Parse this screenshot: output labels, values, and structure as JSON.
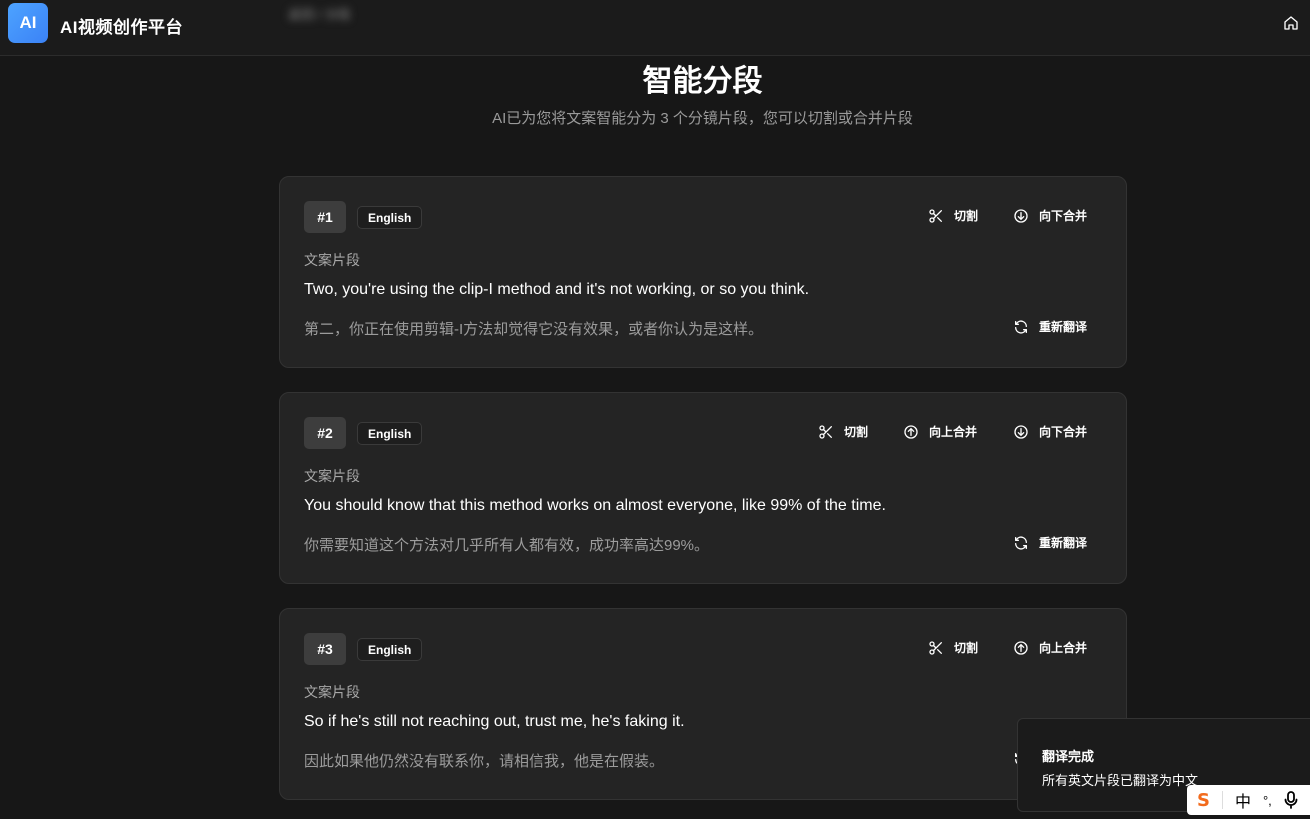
{
  "app": {
    "logo": "AI",
    "title": "AI视频创作平台",
    "breadcrumb_blurred": "返回 / 分段"
  },
  "page": {
    "title": "智能分段",
    "subtitle": "AI已为您将文案智能分为 3 个分镜片段，您可以切割或合并片段"
  },
  "labels": {
    "cut": "切割",
    "merge_up": "向上合并",
    "merge_down": "向下合并",
    "retranslate": "重新翻译",
    "segment_label": "文案片段"
  },
  "segments": [
    {
      "num": "#1",
      "lang": "English",
      "en": "Two, you're using the clip-I method and it's not working, or so you think.",
      "zh": "第二，你正在使用剪辑-I方法却觉得它没有效果，或者你认为是这样。"
    },
    {
      "num": "#2",
      "lang": "English",
      "en": "You should know that this method works on almost everyone, like 99% of the time.",
      "zh": "你需要知道这个方法对几乎所有人都有效，成功率高达99%。"
    },
    {
      "num": "#3",
      "lang": "English",
      "en": "So if he's still not reaching out, trust me, he's faking it.",
      "zh": "因此如果他仍然没有联系你，请相信我，他是在假装。"
    }
  ],
  "toast": {
    "title": "翻译完成",
    "message": "所有英文片段已翻译为中文"
  },
  "ime": {
    "logo": "S",
    "mode": "中",
    "punct": "°,"
  },
  "colors": {
    "background": "#171717",
    "card": "#242424",
    "logo_accent": "#4da3ff",
    "ime_logo": "#f26b1d"
  }
}
